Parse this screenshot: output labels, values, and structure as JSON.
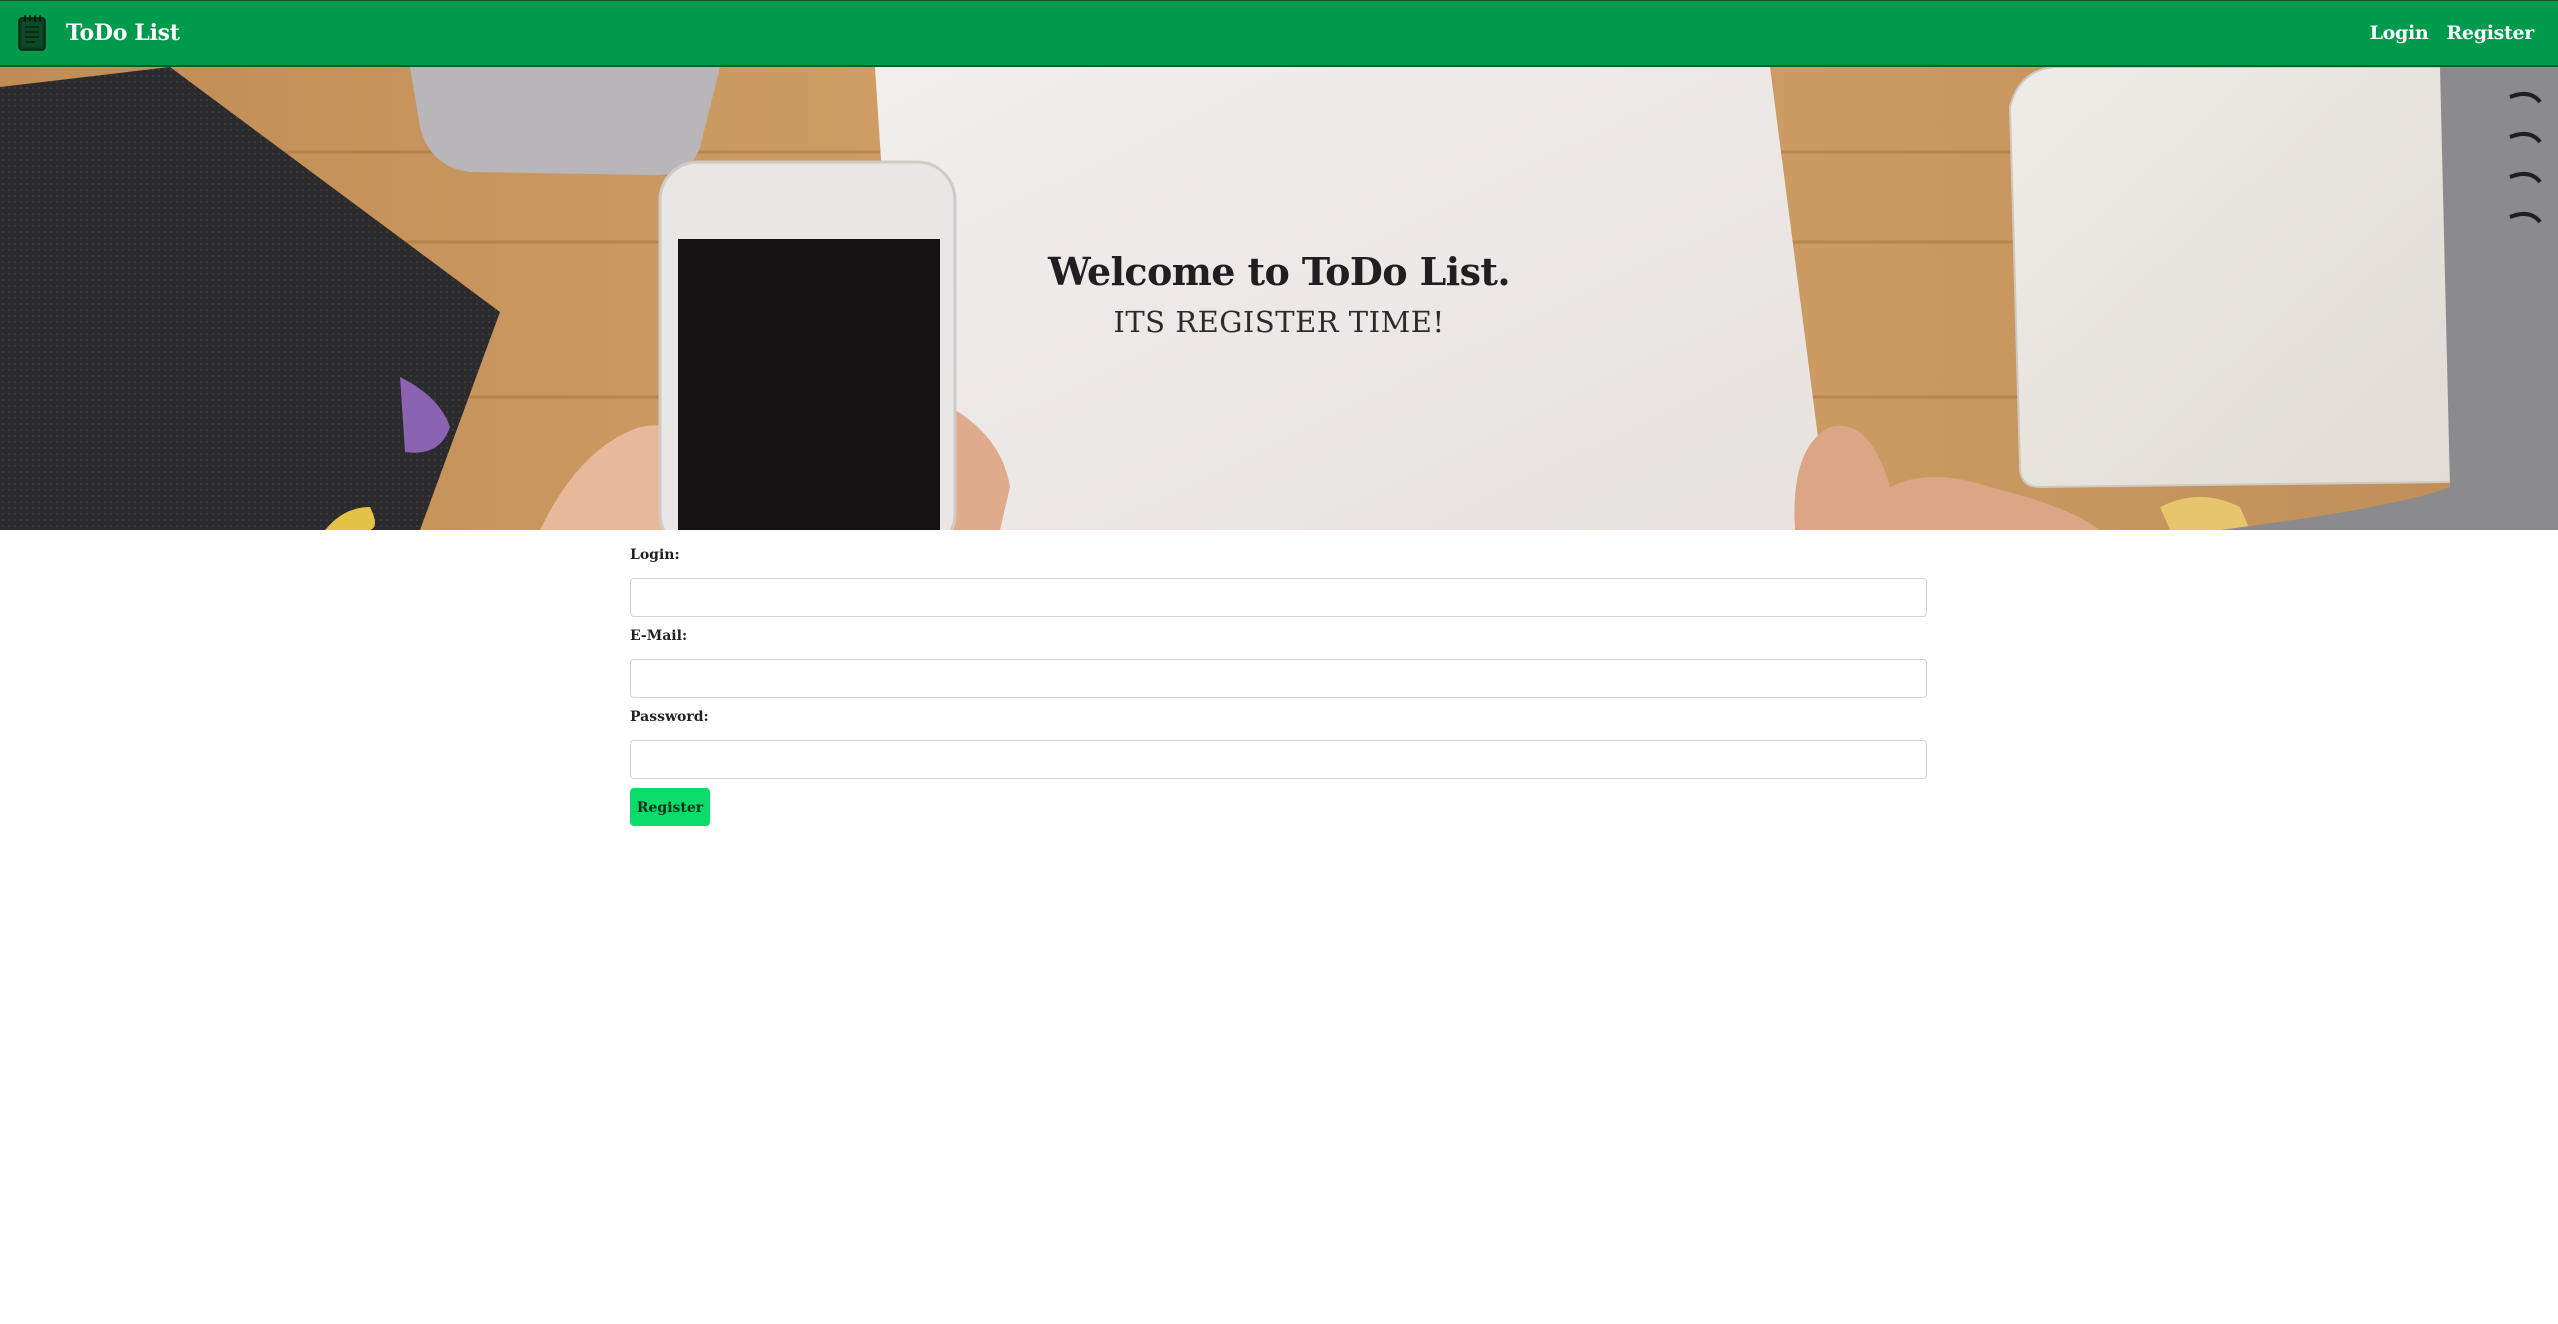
{
  "navbar": {
    "brand_icon": "notepad-icon",
    "brand": "ToDo List",
    "links": {
      "login": "Login",
      "register": "Register"
    },
    "background_color": "#009a4d"
  },
  "hero": {
    "title": "Welcome to ToDo List.",
    "subtitle": "ITS REGISTER TIME!"
  },
  "form": {
    "login_label": "Login:",
    "login_value": "",
    "email_label": "E-Mail:",
    "email_value": "",
    "password_label": "Password:",
    "password_value": "",
    "submit_label": "Register",
    "submit_color": "#0adc6b"
  }
}
